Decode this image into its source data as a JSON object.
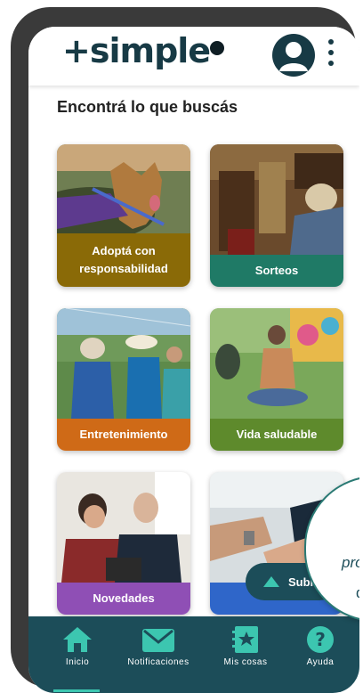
{
  "header": {
    "logo_text": "+simple",
    "avatar_icon": "user-avatar-icon",
    "menu_icon": "more-vertical-icon"
  },
  "main": {
    "title": "Encontrá lo que buscás",
    "cards": [
      {
        "label": "Adoptá con responsabilidad",
        "color": "#8a6a07"
      },
      {
        "label": "Sorteos",
        "color": "#1f7a66"
      },
      {
        "label": "Entretenimiento",
        "color": "#cf6a17"
      },
      {
        "label": "Vida saludable",
        "color": "#5e8a2c"
      },
      {
        "label": "Novedades",
        "color": "#8f4fb5"
      },
      {
        "label": "",
        "color": "#2f66c9"
      }
    ]
  },
  "scroll_top": {
    "label": "Subi",
    "icon": "arrow-up-icon"
  },
  "tooltip": {
    "line1": "pró",
    "line2": "qu"
  },
  "bottom_nav": {
    "items": [
      {
        "label": "Inicio",
        "icon": "home-icon",
        "active": true
      },
      {
        "label": "Notificaciones",
        "icon": "mail-icon"
      },
      {
        "label": "Mis cosas",
        "icon": "notebook-star-icon"
      },
      {
        "label": "Ayuda",
        "icon": "help-icon"
      }
    ],
    "accent": "#3cc6b0",
    "background": "#1c4d59"
  }
}
